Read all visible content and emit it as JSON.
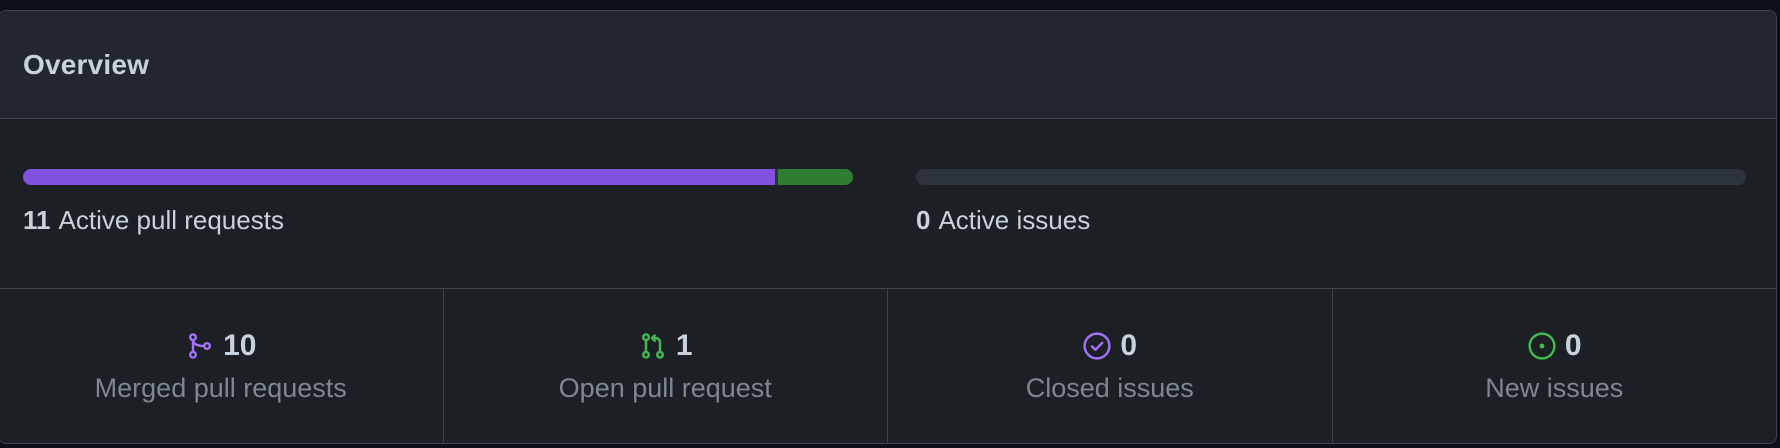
{
  "overview": {
    "title": "Overview"
  },
  "pull_requests_bar": {
    "count": "11",
    "label": "Active pull requests",
    "segments": [
      {
        "name": "merged",
        "value": 10,
        "color": "#8250df"
      },
      {
        "name": "open",
        "value": 1,
        "color": "#2f7d32"
      }
    ]
  },
  "issues_bar": {
    "count": "0",
    "label": "Active issues",
    "track_color": "#2d333b"
  },
  "stats": [
    {
      "icon": "git-merge-icon",
      "color": "#a371f7",
      "count": "10",
      "label": "Merged pull requests"
    },
    {
      "icon": "git-pull-request-icon",
      "color": "#3fb950",
      "count": "1",
      "label": "Open pull request"
    },
    {
      "icon": "issue-closed-icon",
      "color": "#a371f7",
      "count": "0",
      "label": "Closed issues"
    },
    {
      "icon": "issue-opened-icon",
      "color": "#3fb950",
      "count": "0",
      "label": "New issues"
    }
  ]
}
